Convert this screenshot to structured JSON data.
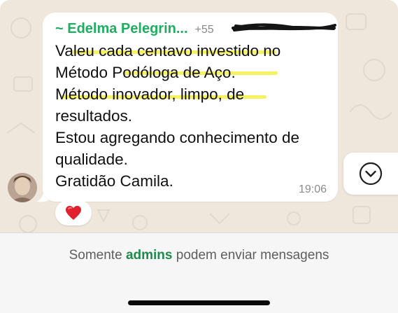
{
  "chat": {
    "message": {
      "sender_name": "~ Edelma Pelegrin...",
      "sender_phone": "+55",
      "lines": [
        "Valeu cada centavo investido no",
        "Método Podóloga de Aço.",
        "Método inovador, limpo, de",
        "resultados.",
        "Estou agregando conhecimento de",
        "qualidade.",
        "Gratidão Camila."
      ],
      "time": "19:06",
      "reaction": "❤️"
    },
    "scroll_down_icon": "chevron-down-circle-icon"
  },
  "footer": {
    "notice_prefix": "Somente",
    "notice_accent": "admins",
    "notice_suffix": "podem enviar mensagens"
  },
  "colors": {
    "sender_name": "#1fae60",
    "highlight": "#f6f150",
    "chat_bg": "#efe7dc",
    "accent": "#1e8a4c"
  }
}
